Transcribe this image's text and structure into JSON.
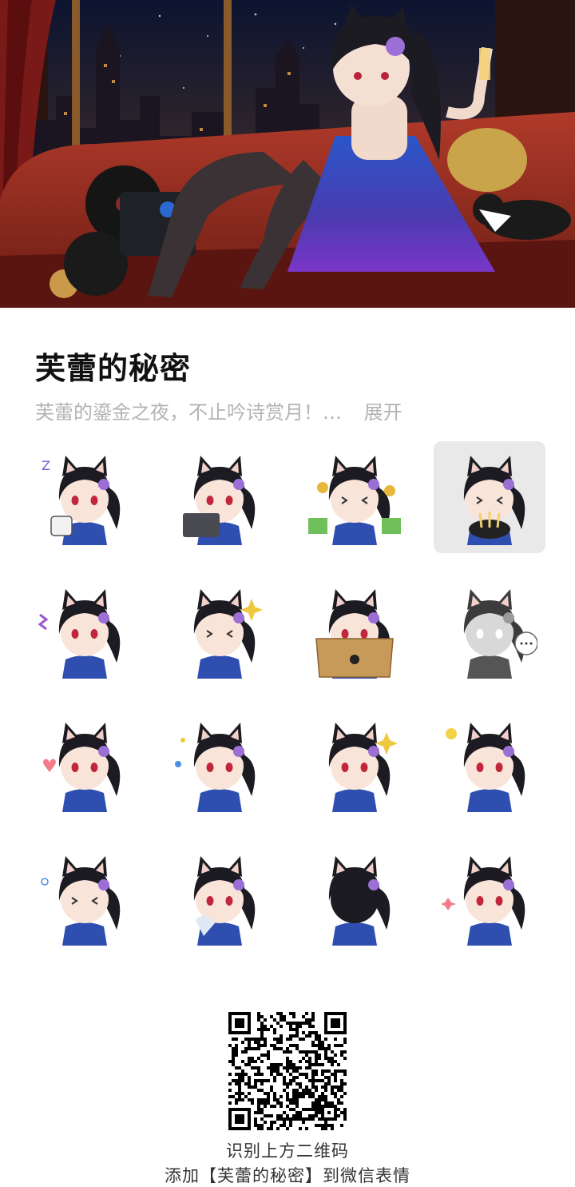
{
  "pack": {
    "title": "芙蕾的秘密",
    "description": "芙蕾的鎏金之夜，不止吟诗赏月！…",
    "expand_label": "展开"
  },
  "banner": {
    "image": "catgirl-on-sofa-illustration"
  },
  "stickers": [
    {
      "name": "sleepy-mug-sticker",
      "selected": false
    },
    {
      "name": "laptop-work-sticker",
      "selected": false
    },
    {
      "name": "money-cheer-sticker",
      "selected": false
    },
    {
      "name": "noodle-bowl-sticker",
      "selected": true
    },
    {
      "name": "shocked-sticker",
      "selected": false
    },
    {
      "name": "laugh-sparkle-sticker",
      "selected": false
    },
    {
      "name": "in-box-sticker",
      "selected": false
    },
    {
      "name": "gray-speechless-sticker",
      "selected": false
    },
    {
      "name": "heart-sticker",
      "selected": false
    },
    {
      "name": "wink-wave-sticker",
      "selected": false
    },
    {
      "name": "side-glance-sticker",
      "selected": false
    },
    {
      "name": "idea-bulb-sticker",
      "selected": false
    },
    {
      "name": "happy-laugh-sticker",
      "selected": false
    },
    {
      "name": "crying-tissue-sticker",
      "selected": false
    },
    {
      "name": "back-view-sticker",
      "selected": false
    },
    {
      "name": "wink-pose-sticker",
      "selected": false
    }
  ],
  "footer": {
    "line1": "识别上方二维码",
    "line2": "添加【芙蕾的秘密】到微信表情"
  },
  "colors": {
    "title": "#111111",
    "description": "#b3b3b3",
    "selected_bg": "#e9e9e9",
    "hair": "#1d1b22",
    "dress": "#2f4fb0",
    "flower": "#9b6fd6"
  }
}
